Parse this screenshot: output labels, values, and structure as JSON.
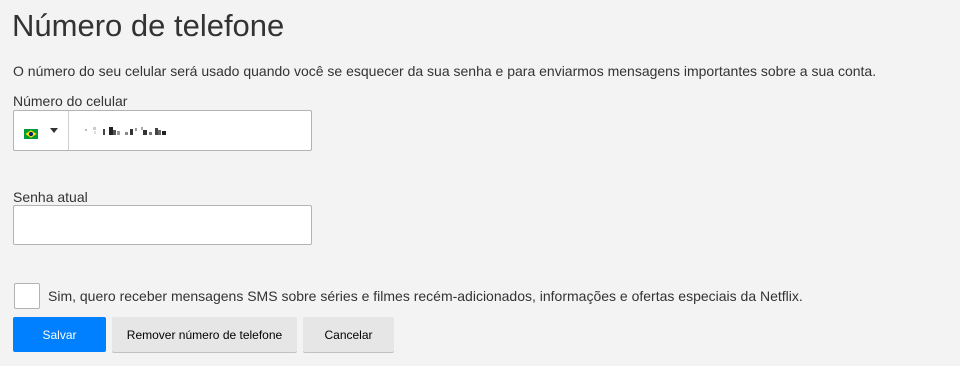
{
  "page": {
    "title": "Número de telefone",
    "description": "O número do seu celular será usado quando você se esquecer da sua senha e para enviarmos mensagens importantes sobre a sua conta."
  },
  "phone": {
    "label": "Número do celular",
    "country_flag": "brazil-flag-icon",
    "value_obscured": true
  },
  "password": {
    "label": "Senha atual",
    "value": "",
    "placeholder": ""
  },
  "sms_opt_in": {
    "checked": false,
    "label": "Sim, quero receber mensagens SMS sobre séries e filmes recém-adicionados, informações e ofertas especiais da Netflix."
  },
  "buttons": {
    "save": "Salvar",
    "remove": "Remover número de telefone",
    "cancel": "Cancelar"
  },
  "colors": {
    "background": "#f3f3f3",
    "primary_button": "#0080ff",
    "secondary_button": "#e6e6e6",
    "text": "#333333"
  }
}
